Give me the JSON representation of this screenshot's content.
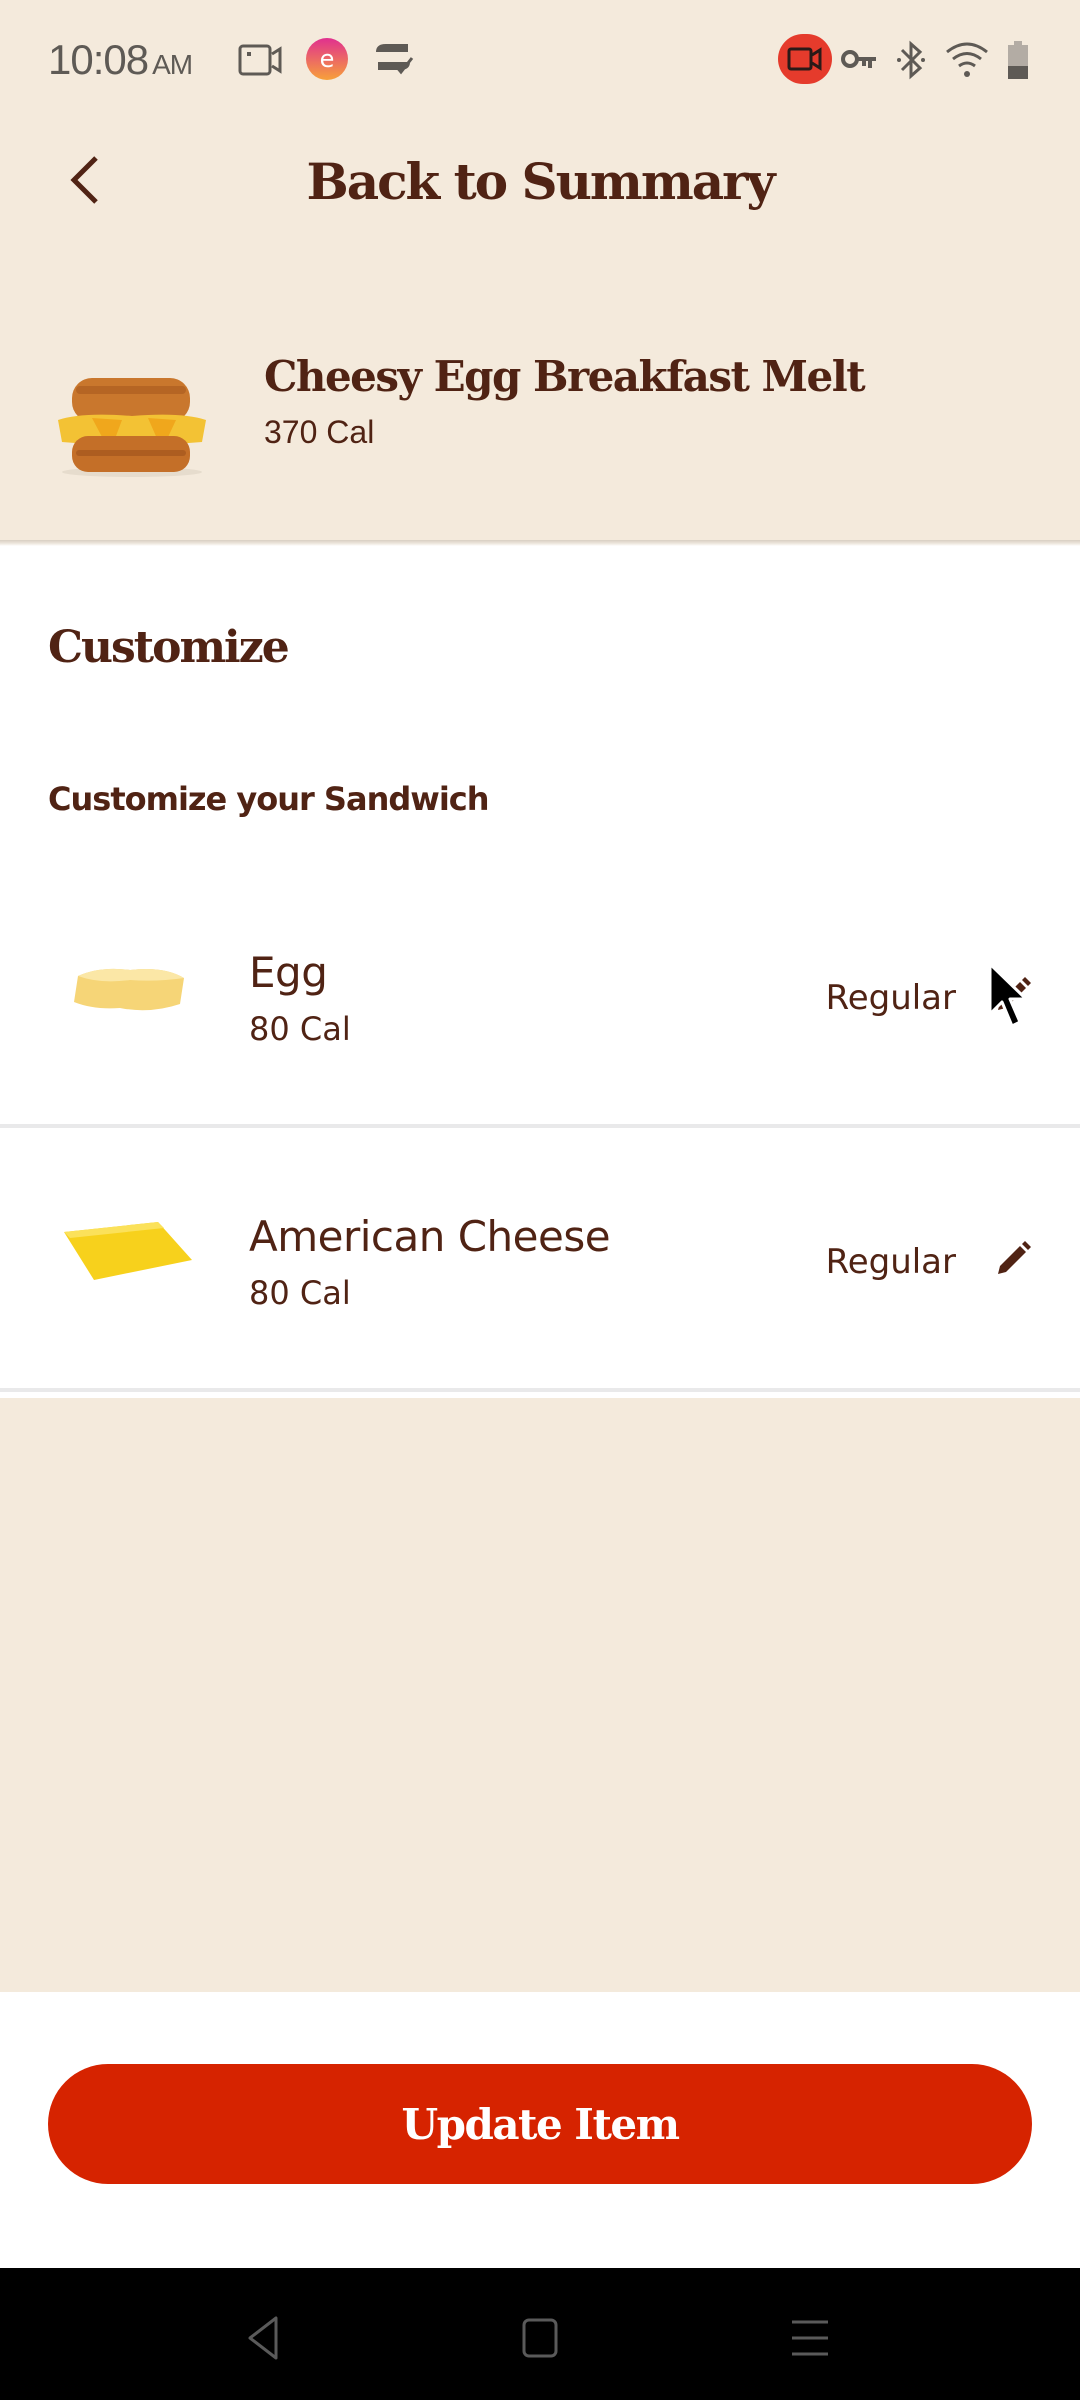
{
  "status_bar": {
    "time": "10:08",
    "ampm": "AM",
    "left_icons": [
      "screen-record-icon",
      "app-notification-icon",
      "sync-check-icon"
    ],
    "right_icons": [
      "recording-indicator-icon",
      "vpn-key-icon",
      "bluetooth-icon",
      "wifi-icon",
      "battery-icon"
    ],
    "recording_color": "#e53b2c"
  },
  "header": {
    "back_icon": "chevron-left-icon",
    "title": "Back to Summary"
  },
  "product": {
    "image": "sandwich-image",
    "name": "Cheesy Egg Breakfast Melt",
    "calories": "370 Cal"
  },
  "customize": {
    "title": "Customize",
    "subtitle": "Customize your Sandwich",
    "items": [
      {
        "name": "Egg",
        "calories": "80 Cal",
        "size": "Regular",
        "image": "egg-image",
        "edit_icon": "pencil-icon"
      },
      {
        "name": "American Cheese",
        "calories": "80 Cal",
        "size": "Regular",
        "image": "cheese-image",
        "edit_icon": "pencil-icon"
      }
    ]
  },
  "footer": {
    "update_label": "Update Item",
    "accent_color": "#d62300"
  },
  "nav_bar": {
    "buttons": [
      "back-nav-icon",
      "home-nav-icon",
      "recents-nav-icon"
    ]
  },
  "colors": {
    "brand_brown": "#502314",
    "background_beige": "#f4eadc",
    "accent_red": "#d62300"
  }
}
